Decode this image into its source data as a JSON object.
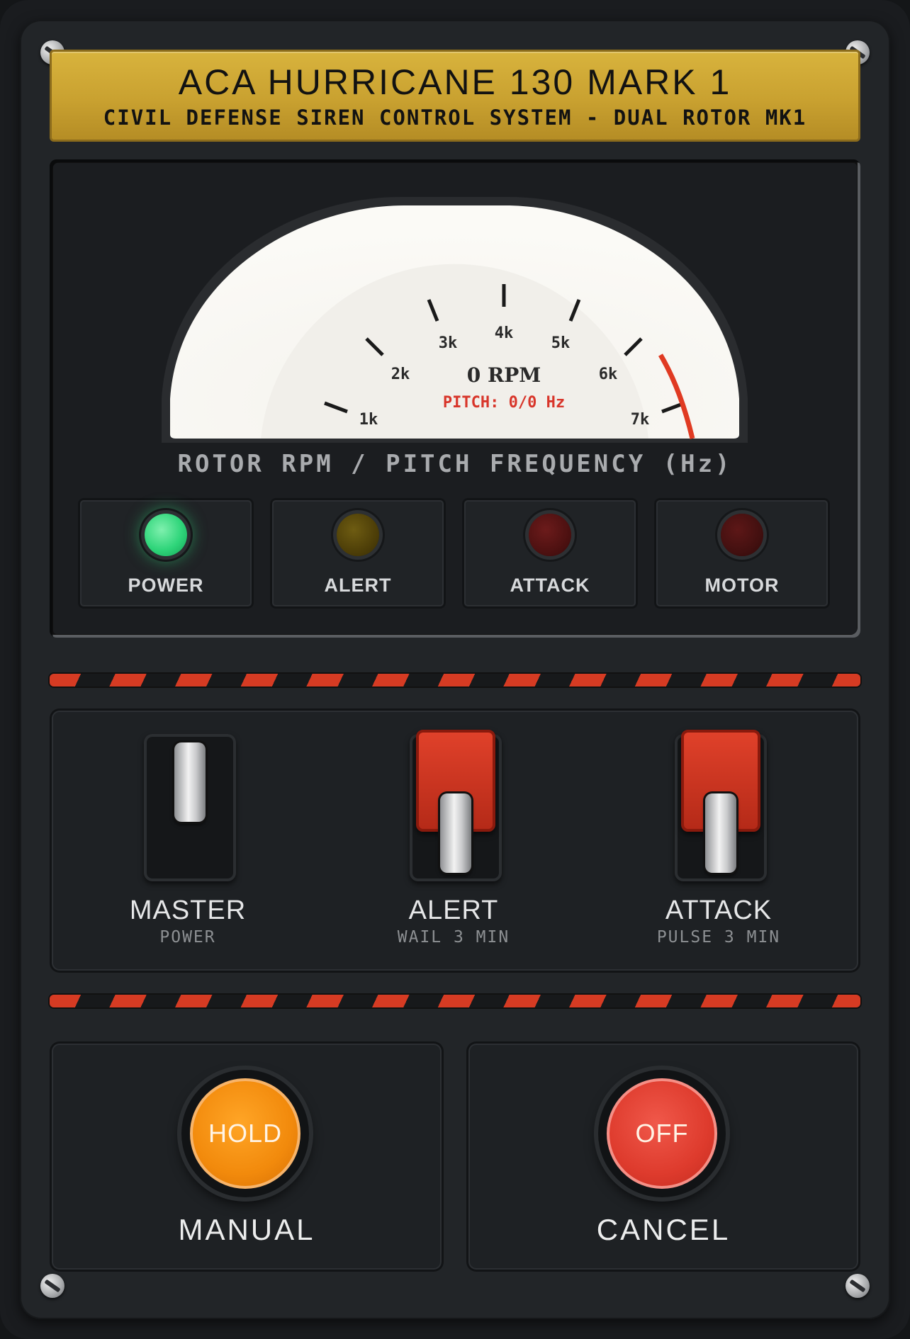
{
  "nameplate": {
    "title": "ACA HURRICANE 130 MARK 1",
    "subtitle": "CIVIL DEFENSE SIREN CONTROL SYSTEM - DUAL ROTOR MK1"
  },
  "gauge": {
    "rpm_readout": "0 RPM",
    "pitch_readout": "PITCH: 0/0 Hz",
    "ticks": [
      "1k",
      "2k",
      "3k",
      "4k",
      "5k",
      "6k",
      "7k"
    ],
    "caption": "ROTOR RPM / PITCH FREQUENCY (Hz)",
    "redline_color": "#e03a22"
  },
  "indicators": [
    {
      "label": "POWER",
      "state": "on",
      "color": "#2fd57a"
    },
    {
      "label": "ALERT",
      "state": "off",
      "color": "#5a4a0a"
    },
    {
      "label": "ATTACK",
      "state": "off",
      "color": "#5a1414"
    },
    {
      "label": "MOTOR",
      "state": "off",
      "color": "#4a1212"
    }
  ],
  "switches": [
    {
      "name": "MASTER",
      "sub": "POWER",
      "covered": false,
      "position": "up"
    },
    {
      "name": "ALERT",
      "sub": "WAIL 3 MIN",
      "covered": true,
      "position": "down"
    },
    {
      "name": "ATTACK",
      "sub": "PULSE 3 MIN",
      "covered": true,
      "position": "down"
    }
  ],
  "buttons": [
    {
      "face": "HOLD",
      "label": "MANUAL",
      "color": "#f28a0c"
    },
    {
      "face": "OFF",
      "label": "CANCEL",
      "color": "#de3b2d"
    }
  ]
}
